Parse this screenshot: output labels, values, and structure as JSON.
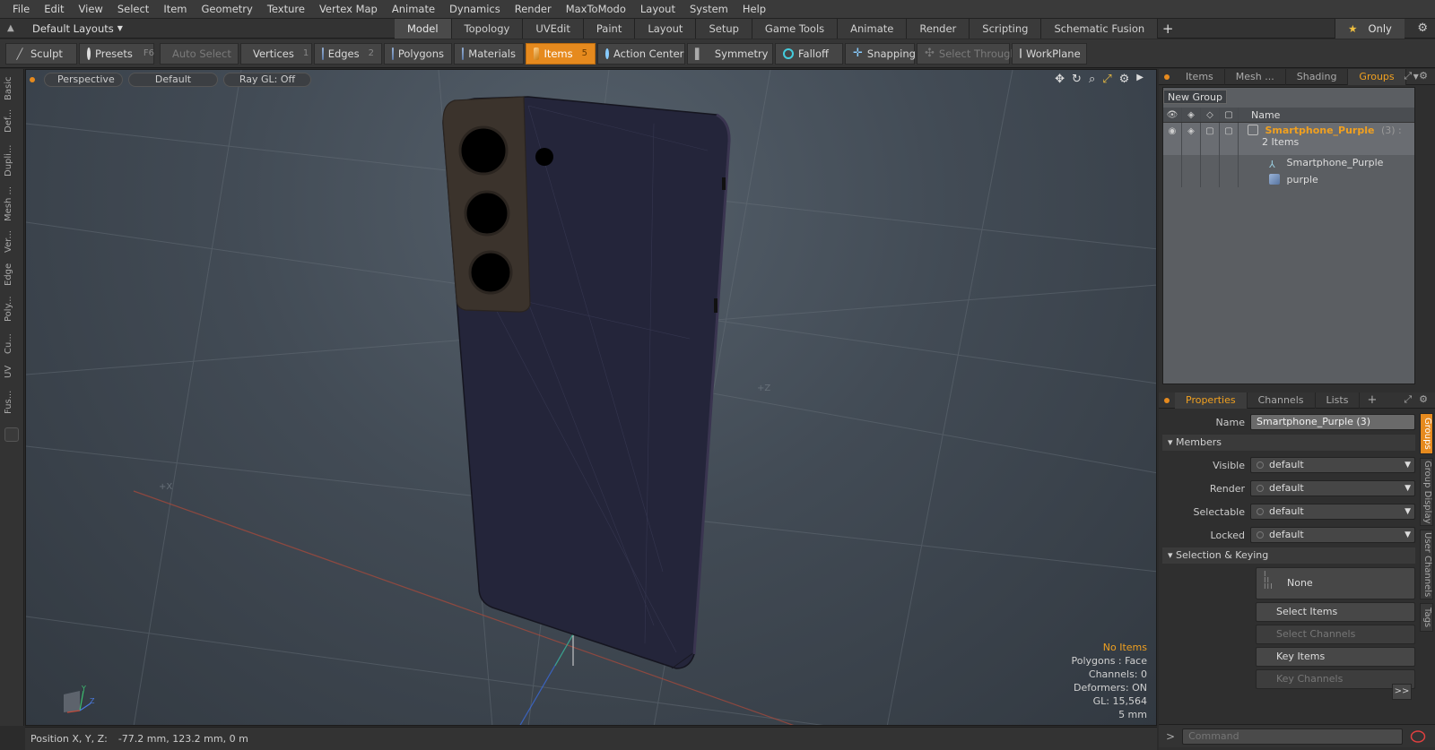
{
  "menu": [
    "File",
    "Edit",
    "View",
    "Select",
    "Item",
    "Geometry",
    "Texture",
    "Vertex Map",
    "Animate",
    "Dynamics",
    "Render",
    "MaxToModo",
    "Layout",
    "System",
    "Help"
  ],
  "layouts": {
    "label": "Default Layouts"
  },
  "tabs": [
    "Model",
    "Topology",
    "UVEdit",
    "Paint",
    "Layout",
    "Setup",
    "Game Tools",
    "Animate",
    "Render",
    "Scripting",
    "Schematic Fusion"
  ],
  "active_tab": "Model",
  "only_label": "Only",
  "toolbar": {
    "sculpt": "Sculpt",
    "presets": "Presets",
    "presets_key": "F6",
    "auto_select": "Auto Select",
    "vertices": "Vertices",
    "vertices_num": "1",
    "edges": "Edges",
    "edges_num": "2",
    "polygons": "Polygons",
    "materials": "Materials",
    "items": "Items",
    "items_num": "5",
    "action_center": "Action Center",
    "symmetry": "Symmetry",
    "falloff": "Falloff",
    "snapping": "Snapping",
    "select_through": "Select Through",
    "workplane": "WorkPlane"
  },
  "left_tabs": [
    "Basic",
    "Def...",
    "Dupli...",
    "Mesh ...",
    "Ver...",
    "Edge",
    "Poly...",
    "Cu...",
    "UV",
    "Fus..."
  ],
  "viewport": {
    "view": "Perspective",
    "shading": "Default",
    "raygl": "Ray GL: Off",
    "axis_x": "+X",
    "axis_z": "+Z",
    "stats": {
      "no_items": "No Items",
      "polygons": "Polygons : Face",
      "channels": "Channels: 0",
      "deformers": "Deformers: ON",
      "gl": "GL: 15,564",
      "scale": "5 mm"
    },
    "colors": {
      "phone_body": "#24253a",
      "camera_bump": "#3b332c",
      "accent": "#e68a1e"
    }
  },
  "status": {
    "label": "Position X, Y, Z:",
    "value": "-77.2 mm, 123.2 mm, 0 m"
  },
  "right_panel": {
    "top_tabs": [
      "Items",
      "Mesh ...",
      "Shading",
      "Groups"
    ],
    "active_top_tab": "Groups",
    "new_group": "New Group",
    "name_header": "Name",
    "group": {
      "name": "Smartphone_Purple",
      "count": "(3) :",
      "items_label": "2 Items"
    },
    "children": [
      "Smartphone_Purple",
      "purple"
    ],
    "bottom_tabs": [
      "Properties",
      "Channels",
      "Lists"
    ],
    "active_bottom_tab": "Properties",
    "props": {
      "name_label": "Name",
      "name_value": "Smartphone_Purple (3)",
      "members": "Members",
      "visible_label": "Visible",
      "visible_value": "default",
      "render_label": "Render",
      "render_value": "default",
      "selectable_label": "Selectable",
      "selectable_value": "default",
      "locked_label": "Locked",
      "locked_value": "default",
      "sel_keying": "Selection & Keying",
      "none": "None",
      "select_items": "Select Items",
      "select_channels": "Select Channels",
      "key_items": "Key Items",
      "key_channels": "Key Channels",
      "more": ">>"
    },
    "side_tabs": [
      "Groups",
      "Group Display",
      "User Channels",
      "Tags"
    ],
    "command_placeholder": "Command"
  }
}
